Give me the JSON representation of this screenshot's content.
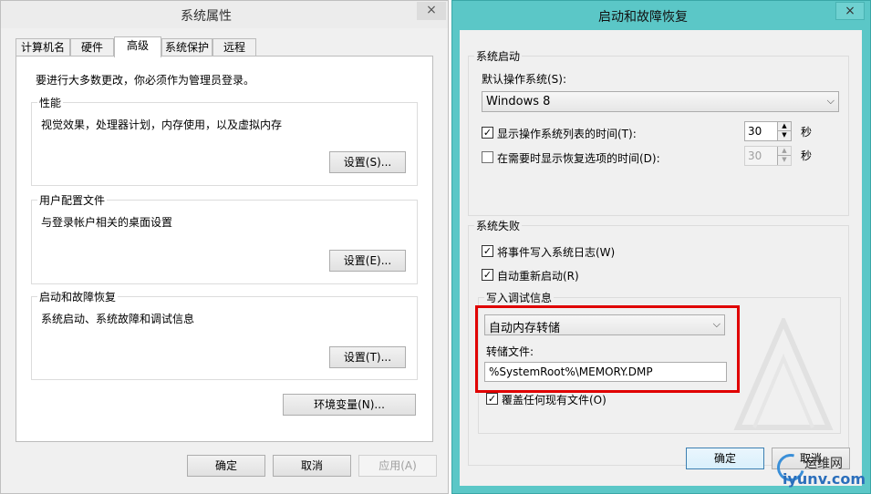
{
  "system_properties": {
    "title": "系统属性",
    "close_label": "×",
    "tabs": [
      "计算机名",
      "硬件",
      "高级",
      "系统保护",
      "远程"
    ],
    "active_tab": "高级",
    "admin_notice": "要进行大多数更改，你必须作为管理员登录。",
    "performance": {
      "title": "性能",
      "description": "视觉效果，处理器计划，内存使用，以及虚拟内存",
      "button": "设置(S)..."
    },
    "user_profiles": {
      "title": "用户配置文件",
      "description": "与登录帐户相关的桌面设置",
      "button": "设置(E)..."
    },
    "startup_recovery": {
      "title": "启动和故障恢复",
      "description": "系统启动、系统故障和调试信息",
      "button": "设置(T)..."
    },
    "env_vars_button": "环境变量(N)...",
    "footer": {
      "ok": "确定",
      "cancel": "取消",
      "apply": "应用(A)"
    }
  },
  "startup_and_recovery": {
    "title": "启动和故障恢复",
    "close_label": "×",
    "system_startup": {
      "group_title": "系统启动",
      "default_os_label": "默认操作系统(S):",
      "default_os_value": "Windows 8",
      "show_os_list": {
        "label": "显示操作系统列表的时间(T):",
        "checked": true,
        "value": "30",
        "unit": "秒"
      },
      "show_recovery": {
        "label": "在需要时显示恢复选项的时间(D):",
        "checked": false,
        "value": "30",
        "unit": "秒"
      }
    },
    "system_failure": {
      "group_title": "系统失败",
      "write_event_log": {
        "label": "将事件写入系统日志(W)",
        "checked": true
      },
      "auto_restart": {
        "label": "自动重新启动(R)",
        "checked": true
      },
      "debug_info": {
        "group_title": "写入调试信息",
        "dump_type": "自动内存转储",
        "dump_file_label": "转储文件:",
        "dump_file_value": "%SystemRoot%\\MEMORY.DMP",
        "overwrite": {
          "label": "覆盖任何现有文件(O)",
          "checked": true
        }
      }
    },
    "footer": {
      "ok": "确定",
      "cancel": "取消"
    }
  },
  "branding": {
    "top": "运维网",
    "bottom": "iyunv.com"
  },
  "colors": {
    "right_window_frame": "#5bc7c7",
    "highlight_box": "#e00000"
  }
}
